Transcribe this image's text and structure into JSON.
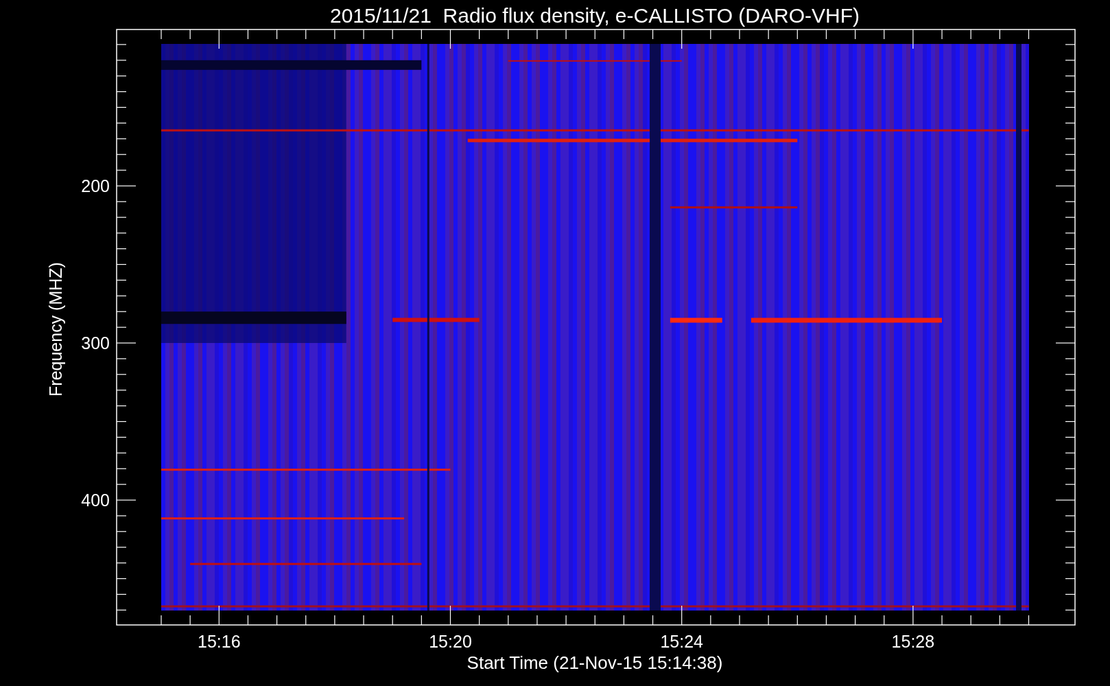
{
  "title": "2015/11/21  Radio flux density, e-CALLISTO (DARO-VHF)",
  "y_axis": {
    "label": "Frequency (MHZ)",
    "ticks": [
      "200",
      "300",
      "400"
    ]
  },
  "x_axis": {
    "label": "Start Time (21-Nov-15 15:14:38)",
    "ticks": [
      "15:16",
      "15:20",
      "15:24",
      "15:28"
    ]
  }
}
